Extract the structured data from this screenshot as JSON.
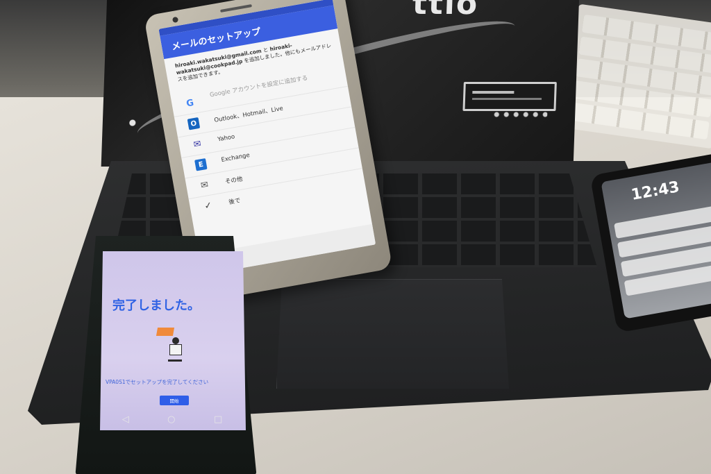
{
  "laptop": {
    "brand_fragment": "ttio"
  },
  "phone_setup": {
    "title": "メールのセットアップ",
    "desc_email1": "hiroaki.wakatsuki@gmail.com",
    "desc_and": " と ",
    "desc_email2": "hiroaki-wakatsuki@cookpad.jp",
    "desc_rest": " を追加しました。他にもメールアドレスを追加できます。",
    "options": [
      {
        "icon": "G",
        "label": "Google アカウントを設定に追加する",
        "muted": true
      },
      {
        "icon": "O",
        "label": "Outlook、Hotmail、Live"
      },
      {
        "icon": "✉",
        "label": "Yahoo"
      },
      {
        "icon": "E",
        "label": "Exchange"
      },
      {
        "icon": "✉",
        "label": "その他"
      },
      {
        "icon": "✓",
        "label": "後で"
      }
    ],
    "back_icon": "‹"
  },
  "phone_done": {
    "title": "完了しました。",
    "subtitle": "VPA0S1でセットアップを完了してください",
    "button": "開始"
  },
  "phone_right": {
    "clock": "12:43"
  },
  "colors": {
    "setup_header": "#3b5fe0",
    "done_accent": "#2f62e4"
  }
}
